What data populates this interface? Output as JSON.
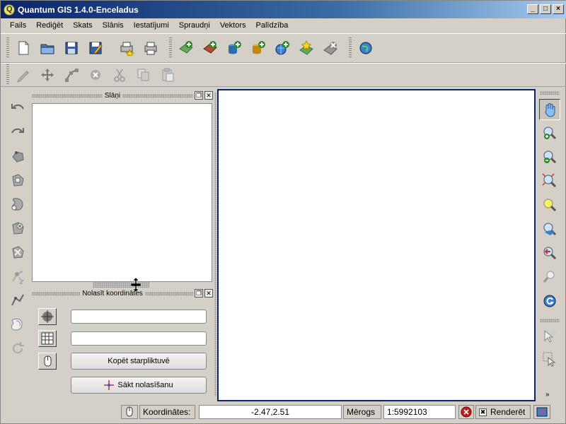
{
  "window": {
    "title": "Quantum GIS 1.4.0-Enceladus",
    "controls": [
      "_",
      "□",
      "×"
    ]
  },
  "menubar": [
    "Fails",
    "Rediģēt",
    "Skats",
    "Slānis",
    "Iestatījumi",
    "Spraudņi",
    "Vektors",
    "Palīdzība"
  ],
  "toolbar_file": [
    "new-project-icon",
    "open-project-icon",
    "save-project-icon",
    "save-as-icon",
    "print-composer-icon",
    "print-icon"
  ],
  "toolbar_layers": [
    "add-vector-layer-icon",
    "add-raster-layer-icon",
    "add-postgis-layer-icon",
    "add-spatialite-layer-icon",
    "add-wms-layer-icon",
    "new-vector-layer-icon",
    "remove-layer-icon"
  ],
  "toolbar_plugins": [
    "globe-plugin-icon"
  ],
  "toolbar_edit": [
    "toggle-editing-icon",
    "move-feature-icon",
    "node-tool-icon",
    "delete-selected-icon",
    "cut-features-icon",
    "copy-features-icon",
    "paste-features-icon"
  ],
  "left_tools": [
    "undo-icon",
    "redo-icon",
    "simplify-icon",
    "add-ring-icon",
    "add-island-icon",
    "delete-ring-icon",
    "delete-part-icon",
    "reshape-icon",
    "split-features-icon",
    "merge-features-icon",
    "rotate-icon"
  ],
  "right_tools": [
    "pan-icon",
    "zoom-in-icon",
    "zoom-out-icon",
    "zoom-full-icon",
    "zoom-selection-icon",
    "zoom-layer-icon",
    "zoom-last-icon",
    "zoom-actual-icon",
    "refresh-icon",
    "identify-icon",
    "select-icon"
  ],
  "layers_panel": {
    "title": "Slāņi"
  },
  "coords_panel": {
    "title": "Nolasīt koordinātes",
    "copy_button": "Kopēt starpliktuvē",
    "start_button": "Sākt nolasīšanu",
    "field1": "",
    "field2": ""
  },
  "statusbar": {
    "coords_label": "Koordinātes:",
    "coords_value": "-2.47,2.51",
    "scale_label": "Mērogs",
    "scale_value": "1:5992103",
    "render_label": "Renderēt"
  },
  "colors": {
    "title_start": "#0a246a",
    "title_end": "#a6caf0",
    "map_border": "#0a246a",
    "accent_green": "#2a8a2a"
  }
}
